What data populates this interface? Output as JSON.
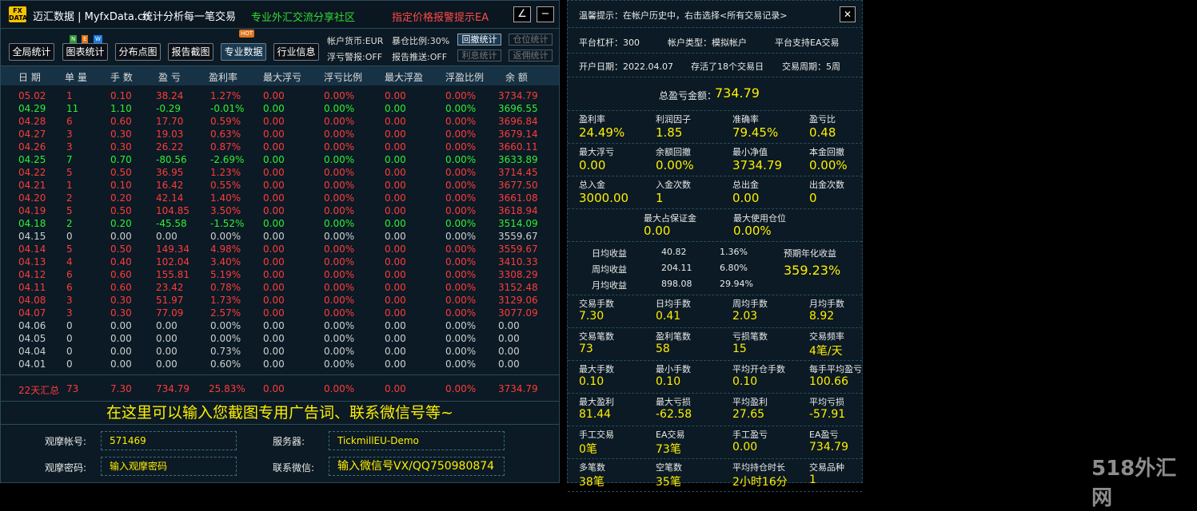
{
  "header": {
    "logo_top": "FX",
    "logo_bottom": "DATA",
    "brand": "迈汇数据 | MyfxData.cn",
    "slogan": "统计分析每一笔交易",
    "community": "专业外汇交流分享社区",
    "ea_promo": "指定价格报警提示EA",
    "edit_icon": "∠",
    "minimize_icon": "−"
  },
  "toolbar": {
    "buttons": [
      "全局统计",
      "图表统计",
      "分布点图",
      "报告截图",
      "专业数据",
      "行业信息"
    ],
    "active_index": 4,
    "new_badge": [
      "N",
      "E",
      "W"
    ],
    "hot_badge": "HOT",
    "account_currency": "帐户货币:EUR",
    "exposure": "暴仓比例:30%",
    "float_alert": "浮亏警报:OFF",
    "report_push": "报告推送:OFF",
    "side_buttons": [
      "回撤统计",
      "仓位统计",
      "利息统计",
      "返佣统计"
    ]
  },
  "table": {
    "headers": [
      "日 期",
      "单 量",
      "手 数",
      "盈 亏",
      "盈利率",
      "最大浮亏",
      "浮亏比例",
      "最大浮盈",
      "浮盈比例",
      "余 额"
    ],
    "rows": [
      {
        "c": "red",
        "v": [
          "05.02",
          "1",
          "0.10",
          "38.24",
          "1.27%",
          "0.00",
          "0.00%",
          "0.00",
          "0.00%",
          "3734.79"
        ]
      },
      {
        "c": "green",
        "v": [
          "04.29",
          "11",
          "1.10",
          "-0.29",
          "-0.01%",
          "0.00",
          "0.00%",
          "0.00",
          "0.00%",
          "3696.55"
        ]
      },
      {
        "c": "red",
        "v": [
          "04.28",
          "6",
          "0.60",
          "17.70",
          "0.59%",
          "0.00",
          "0.00%",
          "0.00",
          "0.00%",
          "3696.84"
        ]
      },
      {
        "c": "red",
        "v": [
          "04.27",
          "3",
          "0.30",
          "19.03",
          "0.63%",
          "0.00",
          "0.00%",
          "0.00",
          "0.00%",
          "3679.14"
        ]
      },
      {
        "c": "red",
        "v": [
          "04.26",
          "3",
          "0.30",
          "26.22",
          "0.87%",
          "0.00",
          "0.00%",
          "0.00",
          "0.00%",
          "3660.11"
        ]
      },
      {
        "c": "green",
        "v": [
          "04.25",
          "7",
          "0.70",
          "-80.56",
          "-2.69%",
          "0.00",
          "0.00%",
          "0.00",
          "0.00%",
          "3633.89"
        ]
      },
      {
        "c": "red",
        "v": [
          "04.22",
          "5",
          "0.50",
          "36.95",
          "1.23%",
          "0.00",
          "0.00%",
          "0.00",
          "0.00%",
          "3714.45"
        ]
      },
      {
        "c": "red",
        "v": [
          "04.21",
          "1",
          "0.10",
          "16.42",
          "0.55%",
          "0.00",
          "0.00%",
          "0.00",
          "0.00%",
          "3677.50"
        ]
      },
      {
        "c": "red",
        "v": [
          "04.20",
          "2",
          "0.20",
          "42.14",
          "1.40%",
          "0.00",
          "0.00%",
          "0.00",
          "0.00%",
          "3661.08"
        ]
      },
      {
        "c": "red",
        "v": [
          "04.19",
          "5",
          "0.50",
          "104.85",
          "3.50%",
          "0.00",
          "0.00%",
          "0.00",
          "0.00%",
          "3618.94"
        ]
      },
      {
        "c": "green",
        "v": [
          "04.18",
          "2",
          "0.20",
          "-45.58",
          "-1.52%",
          "0.00",
          "0.00%",
          "0.00",
          "0.00%",
          "3514.09"
        ]
      },
      {
        "c": "gray",
        "v": [
          "04.15",
          "0",
          "0.00",
          "0.00",
          "0.00%",
          "0.00",
          "0.00%",
          "0.00",
          "0.00%",
          "3559.67"
        ]
      },
      {
        "c": "red",
        "v": [
          "04.14",
          "5",
          "0.50",
          "149.34",
          "4.98%",
          "0.00",
          "0.00%",
          "0.00",
          "0.00%",
          "3559.67"
        ]
      },
      {
        "c": "red",
        "v": [
          "04.13",
          "4",
          "0.40",
          "102.04",
          "3.40%",
          "0.00",
          "0.00%",
          "0.00",
          "0.00%",
          "3410.33"
        ]
      },
      {
        "c": "red",
        "v": [
          "04.12",
          "6",
          "0.60",
          "155.81",
          "5.19%",
          "0.00",
          "0.00%",
          "0.00",
          "0.00%",
          "3308.29"
        ]
      },
      {
        "c": "red",
        "v": [
          "04.11",
          "6",
          "0.60",
          "23.42",
          "0.78%",
          "0.00",
          "0.00%",
          "0.00",
          "0.00%",
          "3152.48"
        ]
      },
      {
        "c": "red",
        "v": [
          "04.08",
          "3",
          "0.30",
          "51.97",
          "1.73%",
          "0.00",
          "0.00%",
          "0.00",
          "0.00%",
          "3129.06"
        ]
      },
      {
        "c": "red",
        "v": [
          "04.07",
          "3",
          "0.30",
          "77.09",
          "2.57%",
          "0.00",
          "0.00%",
          "0.00",
          "0.00%",
          "3077.09"
        ]
      },
      {
        "c": "gray",
        "v": [
          "04.06",
          "0",
          "0.00",
          "0.00",
          "0.00%",
          "0.00",
          "0.00%",
          "0.00",
          "0.00%",
          "0.00"
        ]
      },
      {
        "c": "gray",
        "v": [
          "04.05",
          "0",
          "0.00",
          "0.00",
          "0.00%",
          "0.00",
          "0.00%",
          "0.00",
          "0.00%",
          "0.00"
        ]
      },
      {
        "c": "gray",
        "v": [
          "04.04",
          "0",
          "0.00",
          "0.00",
          "0.73%",
          "0.00",
          "0.00%",
          "0.00",
          "0.00%",
          "0.00"
        ]
      },
      {
        "c": "gray",
        "v": [
          "04.01",
          "0",
          "0.00",
          "0.00",
          "0.60%",
          "0.00",
          "0.00%",
          "0.00",
          "0.00%",
          "0.00"
        ]
      }
    ],
    "summary": [
      "22天汇总",
      "73",
      "7.30",
      "734.79",
      "25.83%",
      "0.00",
      "0.00%",
      "0.00",
      "0.00%",
      "3734.79"
    ]
  },
  "ad_text": "在这里可以输入您截图专用广告词、联系微信号等~",
  "form": {
    "account_label": "观摩帐号:",
    "account_value": "571469",
    "server_label": "服务器:",
    "server_value": "TickmillEU-Demo",
    "password_label": "观摩密码:",
    "password_value": "输入观摩密码",
    "wechat_label": "联系微信:",
    "wechat_value": "输入微信号VX/QQ750980874"
  },
  "right": {
    "tip": "温馨提示：在帐户历史中，右击选择<所有交易记录>",
    "close_icon": "✕",
    "leverage": "平台杠杆：300",
    "account_type": "帐户类型：模拟帐户",
    "ea_support": "平台支持EA交易",
    "open_date": "开户日期：2022.04.07",
    "days_alive": "存活了18个交易日",
    "cycle": "交易周期：5周",
    "total_pnl_label": "总盈亏金额：",
    "total_pnl_value": "734.79",
    "grid1": [
      {
        "l": "盈利率",
        "v": "24.49%"
      },
      {
        "l": "利润因子",
        "v": "1.85"
      },
      {
        "l": "准确率",
        "v": "79.45%"
      },
      {
        "l": "盈亏比",
        "v": "0.48"
      },
      {
        "l": "最大浮亏",
        "v": "0.00"
      },
      {
        "l": "余额回撤",
        "v": "0.00%"
      },
      {
        "l": "最小净值",
        "v": "3734.79"
      },
      {
        "l": "本金回撤",
        "v": "0.00%"
      },
      {
        "l": "总入金",
        "v": "3000.00"
      },
      {
        "l": "入金次数",
        "v": "1"
      },
      {
        "l": "总出金",
        "v": "0.00"
      },
      {
        "l": "出金次数",
        "v": "0"
      }
    ],
    "margin": [
      {
        "l": "最大占保证金",
        "v": "0.00"
      },
      {
        "l": "最大使用仓位",
        "v": "0.00%"
      }
    ],
    "returns": [
      {
        "l": "日均收益",
        "a": "40.82",
        "p": "1.36%"
      },
      {
        "l": "周均收益",
        "a": "204.11",
        "p": "6.80%"
      },
      {
        "l": "月均收益",
        "a": "898.08",
        "p": "29.94%"
      }
    ],
    "annual_label": "预期年化收益",
    "annual_value": "359.23%",
    "grid2": [
      {
        "l": "交易手数",
        "v": "7.30"
      },
      {
        "l": "日均手数",
        "v": "0.41"
      },
      {
        "l": "周均手数",
        "v": "2.03"
      },
      {
        "l": "月均手数",
        "v": "8.92"
      },
      {
        "l": "交易笔数",
        "v": "73"
      },
      {
        "l": "盈利笔数",
        "v": "58"
      },
      {
        "l": "亏损笔数",
        "v": "15"
      },
      {
        "l": "交易频率",
        "v": "4笔/天"
      },
      {
        "l": "最大手数",
        "v": "0.10"
      },
      {
        "l": "最小手数",
        "v": "0.10"
      },
      {
        "l": "平均开仓手数",
        "v": "0.10"
      },
      {
        "l": "每手平均盈亏",
        "v": "100.66"
      },
      {
        "l": "最大盈利",
        "v": "81.44"
      },
      {
        "l": "最大亏损",
        "v": "-62.58"
      },
      {
        "l": "平均盈利",
        "v": "27.65"
      },
      {
        "l": "平均亏损",
        "v": "-57.91"
      },
      {
        "l": "手工交易",
        "v": "0笔"
      },
      {
        "l": "EA交易",
        "v": "73笔"
      },
      {
        "l": "手工盈亏",
        "v": "0.00"
      },
      {
        "l": "EA盈亏",
        "v": "734.79"
      },
      {
        "l": "多笔数",
        "v": "38笔"
      },
      {
        "l": "空笔数",
        "v": "35笔"
      },
      {
        "l": "平均持仓时长",
        "v": "2小时16分"
      },
      {
        "l": "交易品种",
        "v": "1"
      }
    ]
  },
  "watermark": "518外汇网"
}
